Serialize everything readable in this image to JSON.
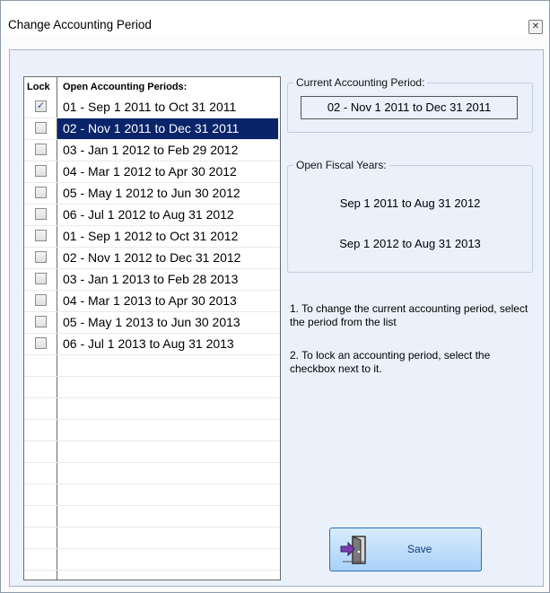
{
  "window": {
    "title": "Change Accounting Period",
    "close_icon": "close-icon"
  },
  "list": {
    "col_lock": "Lock",
    "col_periods": "Open Accounting Periods:",
    "rows": [
      {
        "label": "01 - Sep  1 2011 to Oct 31 2011",
        "checked": true,
        "selected": false
      },
      {
        "label": "02 - Nov  1 2011 to Dec 31 2011",
        "checked": false,
        "selected": true
      },
      {
        "label": "03 - Jan  1 2012 to Feb 29 2012",
        "checked": false,
        "selected": false
      },
      {
        "label": "04 - Mar  1 2012 to Apr 30 2012",
        "checked": false,
        "selected": false
      },
      {
        "label": "05 - May  1 2012 to Jun 30 2012",
        "checked": false,
        "selected": false
      },
      {
        "label": "06 - Jul  1 2012 to Aug 31 2012",
        "checked": false,
        "selected": false
      },
      {
        "label": "01 - Sep  1 2012 to Oct 31 2012",
        "checked": false,
        "selected": false
      },
      {
        "label": "02 - Nov  1 2012 to Dec 31 2012",
        "checked": false,
        "selected": false
      },
      {
        "label": "03 - Jan  1 2013 to Feb 28 2013",
        "checked": false,
        "selected": false
      },
      {
        "label": "04 - Mar  1 2013 to Apr 30 2013",
        "checked": false,
        "selected": false
      },
      {
        "label": "05 - May  1 2013 to Jun 30 2013",
        "checked": false,
        "selected": false
      },
      {
        "label": "06 - Jul  1 2013 to Aug 31 2013",
        "checked": false,
        "selected": false
      }
    ]
  },
  "current_period": {
    "title": "Current Accounting Period:",
    "value": "02 - Nov  1 2011 to Dec 31 2011"
  },
  "fiscal_years": {
    "title": "Open Fiscal Years:",
    "items": [
      "Sep  1 2011 to Aug 31 2012",
      "Sep  1 2012 to Aug 31 2013"
    ]
  },
  "notes": {
    "note1": "1. To change the current accounting period, select the period from the list",
    "note2": "2. To lock an accounting period, select the checkbox next to it."
  },
  "save_button": {
    "label": "Save",
    "icon": "exit-door-icon"
  },
  "colors": {
    "selection": "#0a246a",
    "panel": "#eaf1fb",
    "button": "#aad2f8"
  }
}
